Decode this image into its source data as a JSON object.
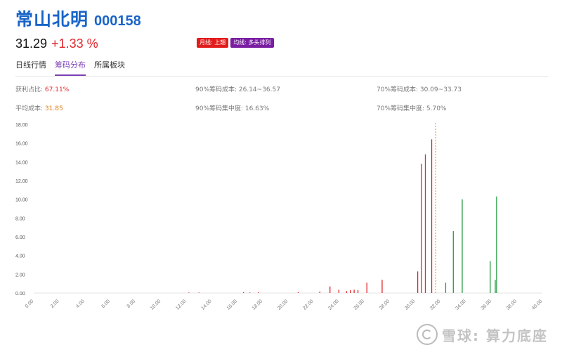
{
  "header": {
    "name": "常山北明",
    "code": "000158",
    "price": "31.29",
    "change": "+1.33 %",
    "tags": [
      "月线: 上翘",
      "均线: 多头排列"
    ]
  },
  "tabs": [
    {
      "label": "日线行情",
      "active": false
    },
    {
      "label": "筹码分布",
      "active": true
    },
    {
      "label": "所属板块",
      "active": false
    }
  ],
  "stats": {
    "profit_ratio_label": "获利占比:",
    "profit_ratio_value": "67.11%",
    "avg_cost_label": "平均成本:",
    "avg_cost_value": "31.85",
    "cost90": "90%筹码成本: 26.14~36.57",
    "conc90": "90%筹码集中度: 16.63%",
    "cost70": "70%筹码成本: 30.09~33.73",
    "conc70": "70%筹码集中度: 5.70%"
  },
  "watermark": "雪球: 算力底座",
  "colors": {
    "red": "#e0262b",
    "green": "#2a9d46",
    "orange": "#f0a000",
    "blue": "#1a64c8"
  },
  "chart_data": {
    "type": "bar",
    "current_price": 31.29,
    "avg_cost": 31.85,
    "x_ticks": [
      "0.00",
      "2.00",
      "4.00",
      "6.00",
      "8.00",
      "10.00",
      "12.00",
      "14.00",
      "16.00",
      "18.00",
      "20.00",
      "22.00",
      "24.00",
      "26.00",
      "28.00",
      "30.00",
      "32.00",
      "34.00",
      "36.00",
      "38.00",
      "40.00"
    ],
    "y_ticks": [
      "0.00",
      "2.00",
      "4.00",
      "6.00",
      "8.00",
      "10.00",
      "12.00",
      "14.00",
      "16.00",
      "18.00"
    ],
    "xlim": [
      0,
      40
    ],
    "ylim": [
      0,
      18
    ],
    "series": [
      {
        "color": "red",
        "points": [
          [
            12.2,
            0.05
          ],
          [
            13.0,
            0.05
          ],
          [
            16.5,
            0.08
          ],
          [
            17.0,
            0.05
          ],
          [
            17.7,
            0.08
          ],
          [
            20.8,
            0.1
          ],
          [
            22.5,
            0.15
          ],
          [
            23.3,
            0.7
          ],
          [
            24.0,
            0.35
          ],
          [
            24.6,
            0.2
          ],
          [
            24.9,
            0.3
          ],
          [
            25.2,
            0.35
          ],
          [
            25.5,
            0.3
          ],
          [
            26.2,
            1.1
          ],
          [
            27.4,
            1.4
          ],
          [
            30.2,
            2.3
          ],
          [
            30.5,
            13.8
          ],
          [
            30.8,
            14.8
          ],
          [
            31.3,
            16.4
          ]
        ]
      },
      {
        "color": "green",
        "points": [
          [
            32.4,
            1.1
          ],
          [
            33.0,
            6.6
          ],
          [
            33.7,
            10.0
          ],
          [
            35.9,
            3.4
          ],
          [
            36.3,
            1.4
          ],
          [
            36.4,
            10.3
          ]
        ]
      }
    ]
  }
}
